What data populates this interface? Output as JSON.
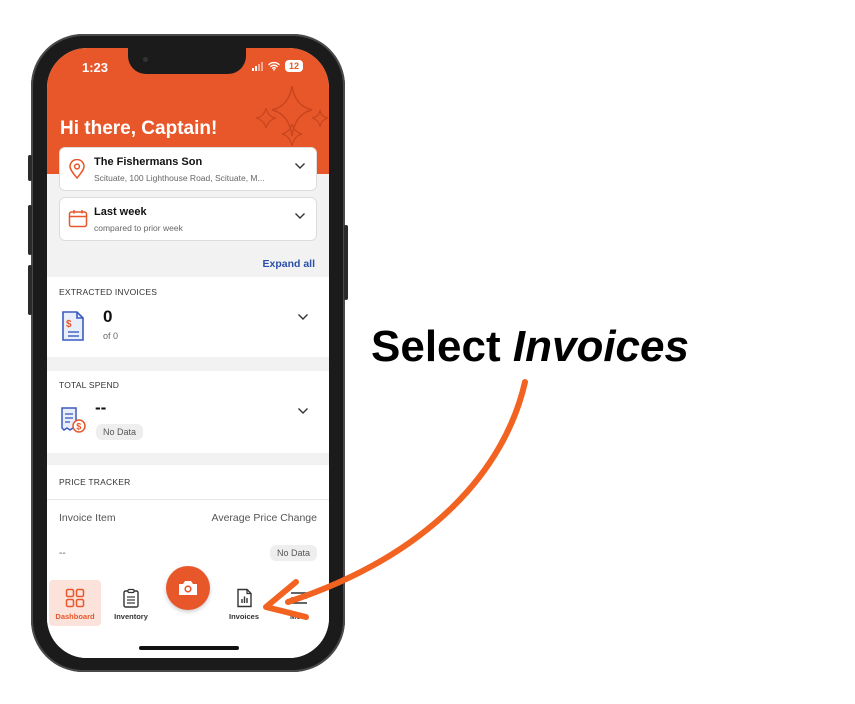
{
  "status_bar": {
    "time": "1:23",
    "battery": "12"
  },
  "header": {
    "greeting": "Hi there, Captain!"
  },
  "location": {
    "name": "The Fishermans Son",
    "address": "Scituate, 100 Lighthouse Road, Scituate, M..."
  },
  "period": {
    "name": "Last week",
    "comparison": "compared to prior week"
  },
  "expand_all": "Expand all",
  "extracted_invoices": {
    "label": "EXTRACTED INVOICES",
    "value": "0",
    "of": "of 0"
  },
  "total_spend": {
    "label": "TOTAL SPEND",
    "value": "--",
    "badge": "No Data"
  },
  "price_tracker": {
    "label": "PRICE TRACKER",
    "col_item": "Invoice Item",
    "col_change": "Average Price Change",
    "row_item": "--",
    "row_badge": "No Data"
  },
  "tabs": [
    {
      "label": "Dashboard",
      "icon": "grid-icon",
      "active": true
    },
    {
      "label": "Inventory",
      "icon": "clipboard-icon",
      "active": false
    },
    {
      "label": "Invoices",
      "icon": "document-chart-icon",
      "active": false
    },
    {
      "label": "More",
      "icon": "menu-icon",
      "active": false
    }
  ],
  "callout": {
    "prefix": "Select ",
    "emphasis": "Invoices"
  },
  "colors": {
    "brand": "#e8572a",
    "link": "#2b4ea8",
    "arrow": "#f26322",
    "icon_blue": "#3b5bbf"
  }
}
